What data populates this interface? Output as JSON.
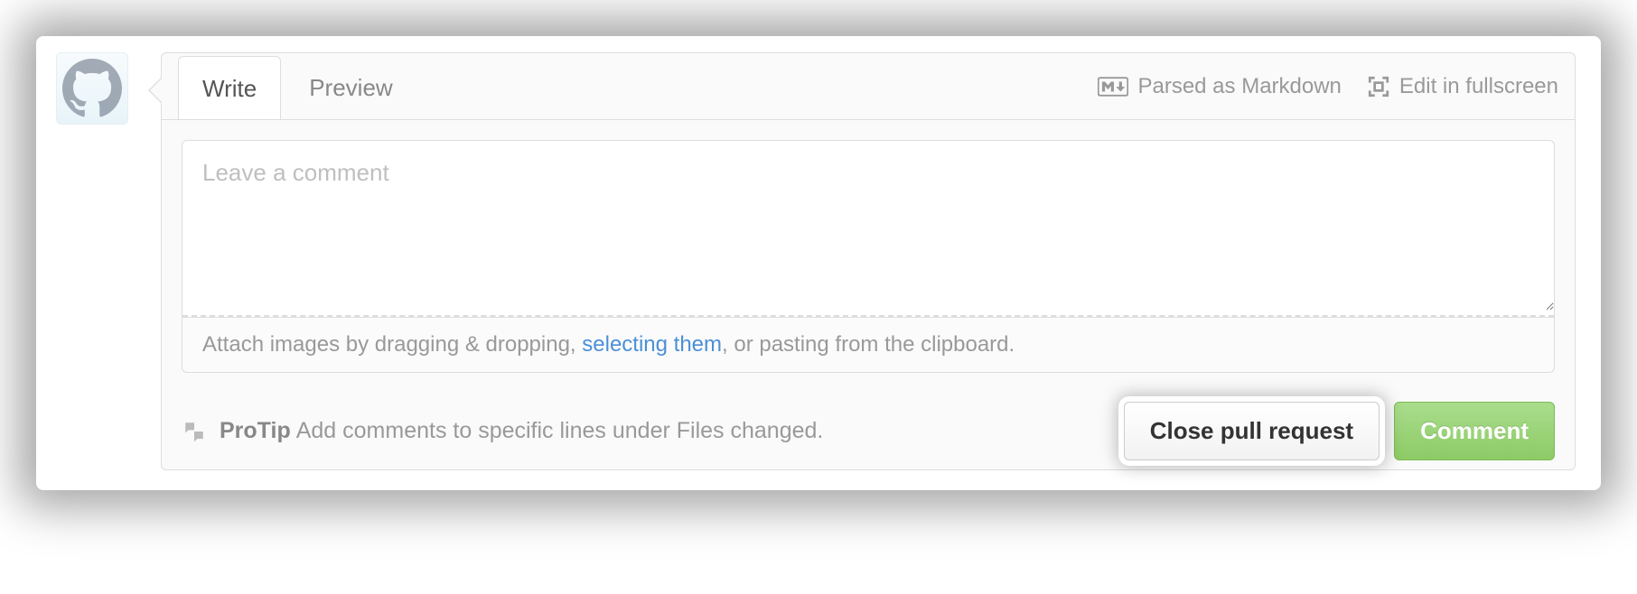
{
  "tabs": {
    "write": "Write",
    "preview": "Preview"
  },
  "hints": {
    "markdown": "Parsed as Markdown",
    "fullscreen": "Edit in fullscreen"
  },
  "textarea": {
    "placeholder": "Leave a comment"
  },
  "attach": {
    "prefix": "Attach images by dragging & dropping, ",
    "link": "selecting them",
    "suffix": ", or pasting from the clipboard."
  },
  "protip": {
    "label": "ProTip",
    "text": "Add comments to specific lines under Files changed."
  },
  "buttons": {
    "close": "Close pull request",
    "comment": "Comment"
  }
}
